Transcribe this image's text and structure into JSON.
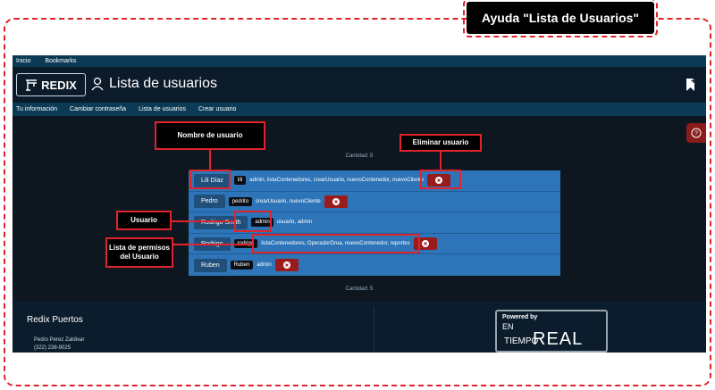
{
  "help_title": "Ayuda \"Lista de Usuarios\"",
  "app": {
    "topnav": [
      "Inicio",
      "Bookmarks"
    ],
    "logo_text": "REDIX",
    "page_title": "Lista de usuarios",
    "subnav": [
      "Tu información",
      "Cambiar contraseña",
      "Lista de usuarios",
      "Crear usuario"
    ],
    "count_label": "Cantidad: 5",
    "users": [
      {
        "name": "Lili Díaz",
        "username": "lili",
        "perms": "admin, listaContenedores, crearUsuario, nuevoContenedor, nuevoCliente"
      },
      {
        "name": "Pedro",
        "username": "pedrito",
        "perms": "crearUsuario, nuevoCliente"
      },
      {
        "name": "Rodrigo Smith",
        "username": "admin",
        "perms": "usuario, admin"
      },
      {
        "name": "Rodrigo",
        "username": "rodrigo",
        "perms": "listaContenedores, OperadorGrua, nuevoContenedor, reportes"
      },
      {
        "name": "Ruben",
        "username": "Ruben",
        "perms": "admin"
      }
    ],
    "footer": {
      "company": "Redix Puertos",
      "contact_name": "Pedro Perez Zaldivar",
      "contact_phone": "(322) 238-9025",
      "powered_by": "Powered by",
      "brand_en": "EN",
      "brand_tiempo": "TIEMPO",
      "brand_real": "REAL"
    }
  },
  "annotations": {
    "nombre_usuario": "Nombre de usuario",
    "eliminar_usuario": "Eliminar usuario",
    "usuario": "Usuario",
    "lista_permisos": "Lista de permisos del Usuario"
  },
  "colors": {
    "accent_red": "#e0242b",
    "panel_blue": "#2d75b8",
    "header_bg": "#0c1b2a"
  }
}
